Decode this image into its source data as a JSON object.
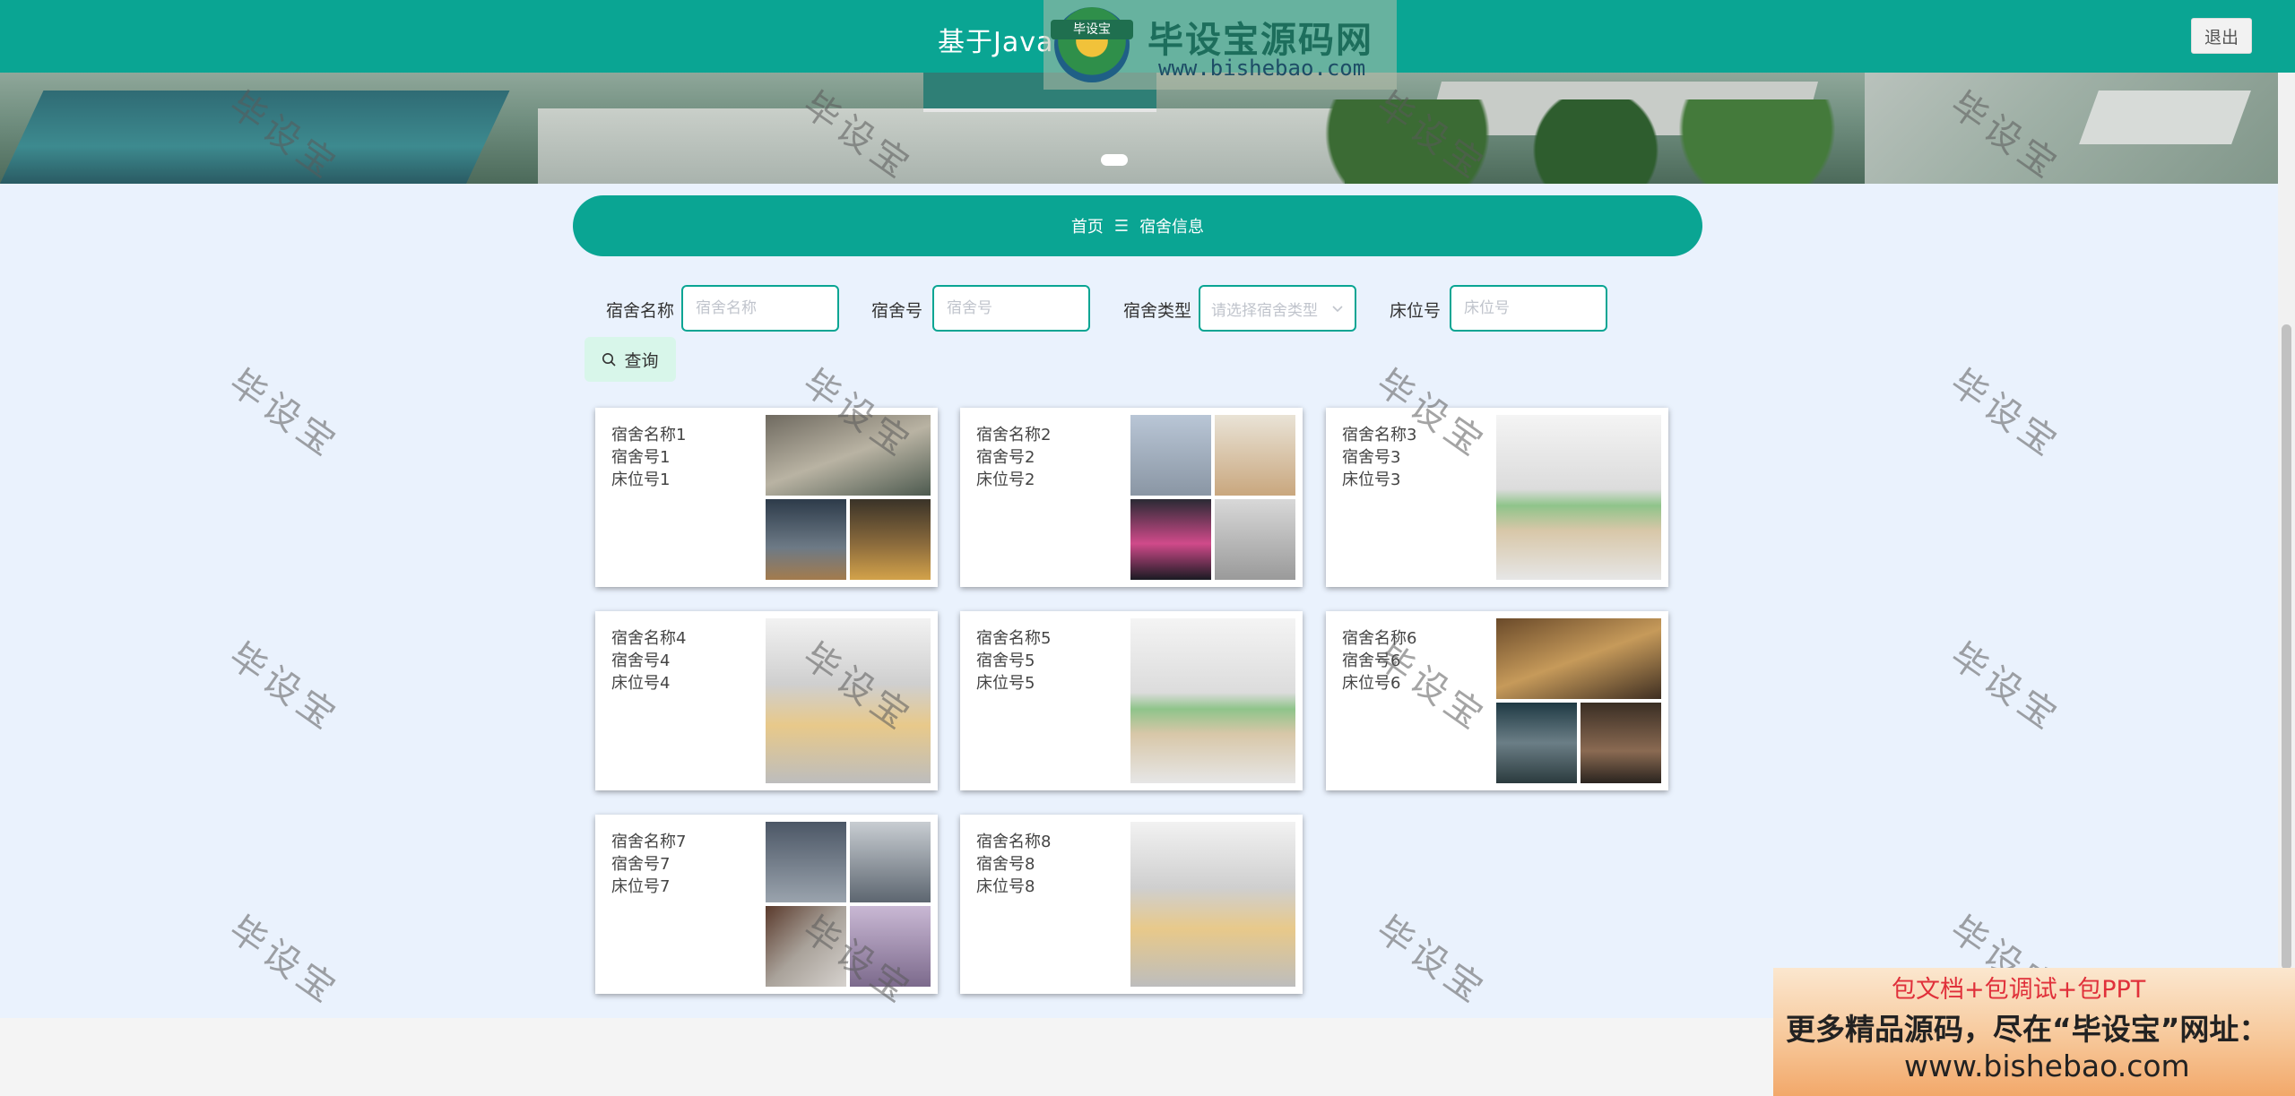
{
  "header": {
    "title": "基于Java的",
    "logout_label": "退出",
    "logo_band": "毕设宝",
    "logo_text": "毕设宝源码网",
    "logo_url": "www.bishebao.com"
  },
  "breadcrumb": {
    "home": "首页",
    "separator": "☰",
    "current": "宿舍信息"
  },
  "search": {
    "name_label": "宿舍名称",
    "name_placeholder": "宿舍名称",
    "number_label": "宿舍号",
    "number_placeholder": "宿舍号",
    "type_label": "宿舍类型",
    "type_placeholder": "请选择宿舍类型",
    "bed_label": "床位号",
    "bed_placeholder": "床位号",
    "query_label": "查询"
  },
  "cards": [
    {
      "name": "宿舍名称1",
      "number": "宿舍号1",
      "bed": "床位号1"
    },
    {
      "name": "宿舍名称2",
      "number": "宿舍号2",
      "bed": "床位号2"
    },
    {
      "name": "宿舍名称3",
      "number": "宿舍号3",
      "bed": "床位号3"
    },
    {
      "name": "宿舍名称4",
      "number": "宿舍号4",
      "bed": "床位号4"
    },
    {
      "name": "宿舍名称5",
      "number": "宿舍号5",
      "bed": "床位号5"
    },
    {
      "name": "宿舍名称6",
      "number": "宿舍号6",
      "bed": "床位号6"
    },
    {
      "name": "宿舍名称7",
      "number": "宿舍号7",
      "bed": "床位号7"
    },
    {
      "name": "宿舍名称8",
      "number": "宿舍号8",
      "bed": "床位号8"
    }
  ],
  "watermark": "毕设宝",
  "promo": {
    "line1": "包文档+包调试+包PPT",
    "line2": "更多精品源码，尽在“毕设宝”网址：",
    "line3": "www.bishebao.com"
  },
  "colors": {
    "accent": "#0aa593",
    "page_background": "#eaf2fd",
    "query_button": "#d8f6ea",
    "promo_red": "#e0303a"
  }
}
